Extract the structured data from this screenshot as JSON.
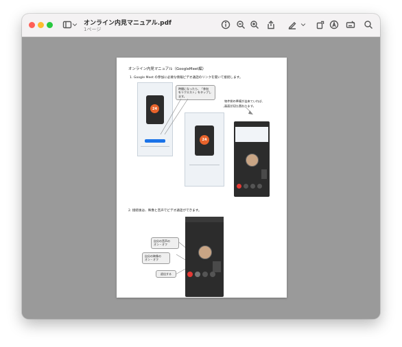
{
  "window": {
    "title": "オンライン内見マニュアル.pdf",
    "subtitle": "1ページ"
  },
  "toolbar": {
    "icons": [
      "sidebar-icon",
      "chevron-down-icon",
      "info-icon",
      "zoom-out-icon",
      "zoom-in-icon",
      "share-icon",
      "markup-pen-icon",
      "chevron-down-icon",
      "rotate-icon",
      "annotate-icon",
      "form-icon",
      "search-icon"
    ]
  },
  "document": {
    "heading": "オンライン内見マニュアル（GoogleMeet編）",
    "step1": "1. Google Meet の参加に必要な情報ビデオ通話のリンクを開いて接続します。",
    "bubble_time_1": "時間になったら、「参加",
    "bubble_time_2": "をリクエスト」をタップし",
    "bubble_time_3": "ます。",
    "note_1": "物件側の準備が出来ていれば、",
    "note_2": "画面が切り替わります。",
    "timer": "24",
    "timer2": "24",
    "step2": "2. 接続後は、映像と音声でビデオ通話ができます。",
    "bubble_audio_1": "自分の音声の",
    "bubble_audio_2": "オン・オフ",
    "bubble_video_1": "自分の映像の",
    "bubble_video_2": "オン・オフ",
    "bubble_leave": "退出する"
  },
  "colors": {
    "accent_orange": "#e8632b",
    "leave_red": "#e53935"
  }
}
